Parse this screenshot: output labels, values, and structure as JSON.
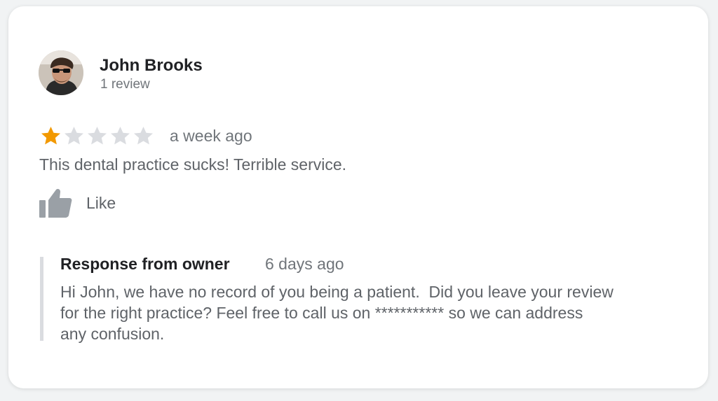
{
  "review": {
    "reviewer": {
      "name": "John Brooks",
      "review_count": "1 review",
      "avatar_icon": "profile-photo-avatar"
    },
    "rating": {
      "value": 1,
      "max": 5,
      "filled_color": "#f29900",
      "empty_color": "#dadce0"
    },
    "time": "a week ago",
    "text": "This dental practice sucks! Terrible service.",
    "like": {
      "label": "Like",
      "icon": "thumbs-up-icon"
    }
  },
  "owner_response": {
    "title": "Response from owner",
    "time": "6 days ago",
    "lines": [
      "Hi John, we have no record of you being a patient.  Did you leave your review",
      "for the right practice? Feel free to call us on *********** so we can address",
      "any confusion."
    ]
  }
}
